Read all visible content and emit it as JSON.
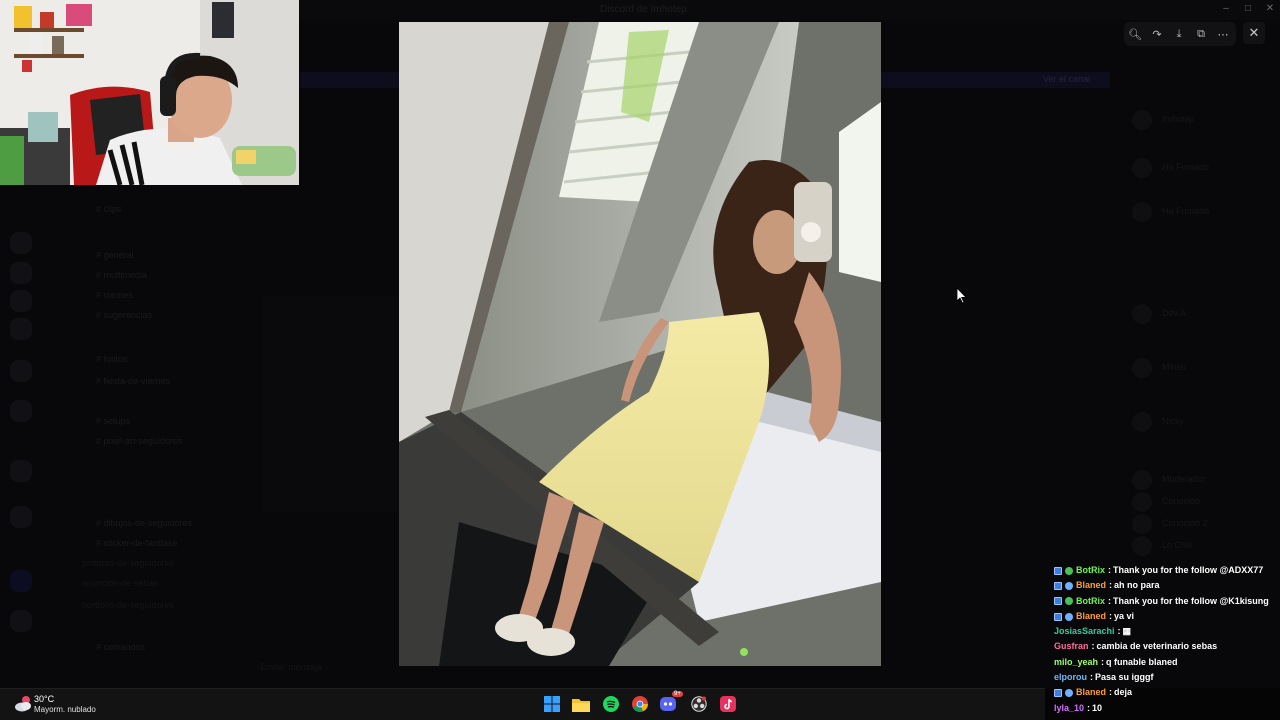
{
  "backdrop": {
    "window_title": "Discord de Imhotep",
    "banner_text": "Ver el canal",
    "channels": [
      {
        "label": "# clips",
        "section": false
      },
      {
        "label": "# general",
        "section": false
      },
      {
        "label": "# multimedia",
        "section": false
      },
      {
        "label": "# memes",
        "section": false
      },
      {
        "label": "# sugerencias",
        "section": false
      },
      {
        "label": "# fotitos",
        "section": false
      },
      {
        "label": "# fiesta-de-viernes",
        "section": false
      },
      {
        "label": "# setups",
        "section": false
      },
      {
        "label": "# pixel-art-seguidores",
        "section": false
      },
      {
        "label": "# dibujos-de-seguidores",
        "section": false
      },
      {
        "label": "# sticker-de-fanbase",
        "section": false
      },
      {
        "label": "pinturas-de-seguidores",
        "section": true
      },
      {
        "label": "anuncios-de-sebas",
        "section": true
      },
      {
        "label": "portfolio-de-seguidores",
        "section": true
      },
      {
        "label": "# comandos",
        "section": false
      }
    ],
    "members": [
      "Imhotep",
      "Ha Fumado",
      "Ha Fumado",
      "Dev A",
      "Minsu",
      "Nicky",
      "Moderador",
      "Conocido",
      "Conocido 2",
      "Lo Chill"
    ],
    "chat_input_placeholder": "Enviar mensaje"
  },
  "window_controls": {
    "minimize": "–",
    "maximize": "□",
    "close": "✕"
  },
  "viewer_toolbar": [
    {
      "name": "zoom-icon",
      "glyph": "🔍︎"
    },
    {
      "name": "share-icon",
      "glyph": "↷"
    },
    {
      "name": "download-icon",
      "glyph": "⤓"
    },
    {
      "name": "open-external-icon",
      "glyph": "⧉"
    },
    {
      "name": "more-icon",
      "glyph": "⋯"
    }
  ],
  "viewer_close": "✕",
  "stream_chat": [
    {
      "user": "BotRix",
      "user_color": "#6cf54c",
      "badges": [
        "b1",
        "b2"
      ],
      "text": "Thank you for the follow @ADXX77"
    },
    {
      "user": "Blaned",
      "user_color": "#ff9c33",
      "badges": [
        "b1",
        "b3"
      ],
      "text": "ah no para"
    },
    {
      "user": "BotRix",
      "user_color": "#6cf54c",
      "badges": [
        "b1",
        "b2"
      ],
      "text": "Thank you for the follow @K1kisung"
    },
    {
      "user": "Blaned",
      "user_color": "#ff9c33",
      "badges": [
        "b1",
        "b3"
      ],
      "text": "ya vi"
    },
    {
      "user": "JosiasSarachi",
      "user_color": "#2ecc9b",
      "badges": [],
      "text": "▦"
    },
    {
      "user": "Gusfran",
      "user_color": "#ff6b9d",
      "badges": [],
      "text": "cambia de veterinario sebas"
    },
    {
      "user": "milo_yeah",
      "user_color": "#9dff6b",
      "badges": [],
      "text": "q funable blaned"
    },
    {
      "user": "elporou",
      "user_color": "#6bb8ff",
      "badges": [],
      "text": "Pasa su igggf"
    },
    {
      "user": "Blaned",
      "user_color": "#ff9c33",
      "badges": [
        "b1",
        "b3"
      ],
      "text": "deja"
    },
    {
      "user": "lyla_10",
      "user_color": "#d66bff",
      "badges": [],
      "text": "10"
    }
  ],
  "weather": {
    "temp": "30°C",
    "desc": "Mayorm. nublado"
  },
  "taskbar_apps": [
    {
      "name": "windows-start-icon"
    },
    {
      "name": "file-explorer-icon"
    },
    {
      "name": "spotify-icon"
    },
    {
      "name": "chrome-icon"
    },
    {
      "name": "discord-icon",
      "badge": "9+"
    },
    {
      "name": "obs-icon"
    },
    {
      "name": "tiktok-icon"
    }
  ]
}
